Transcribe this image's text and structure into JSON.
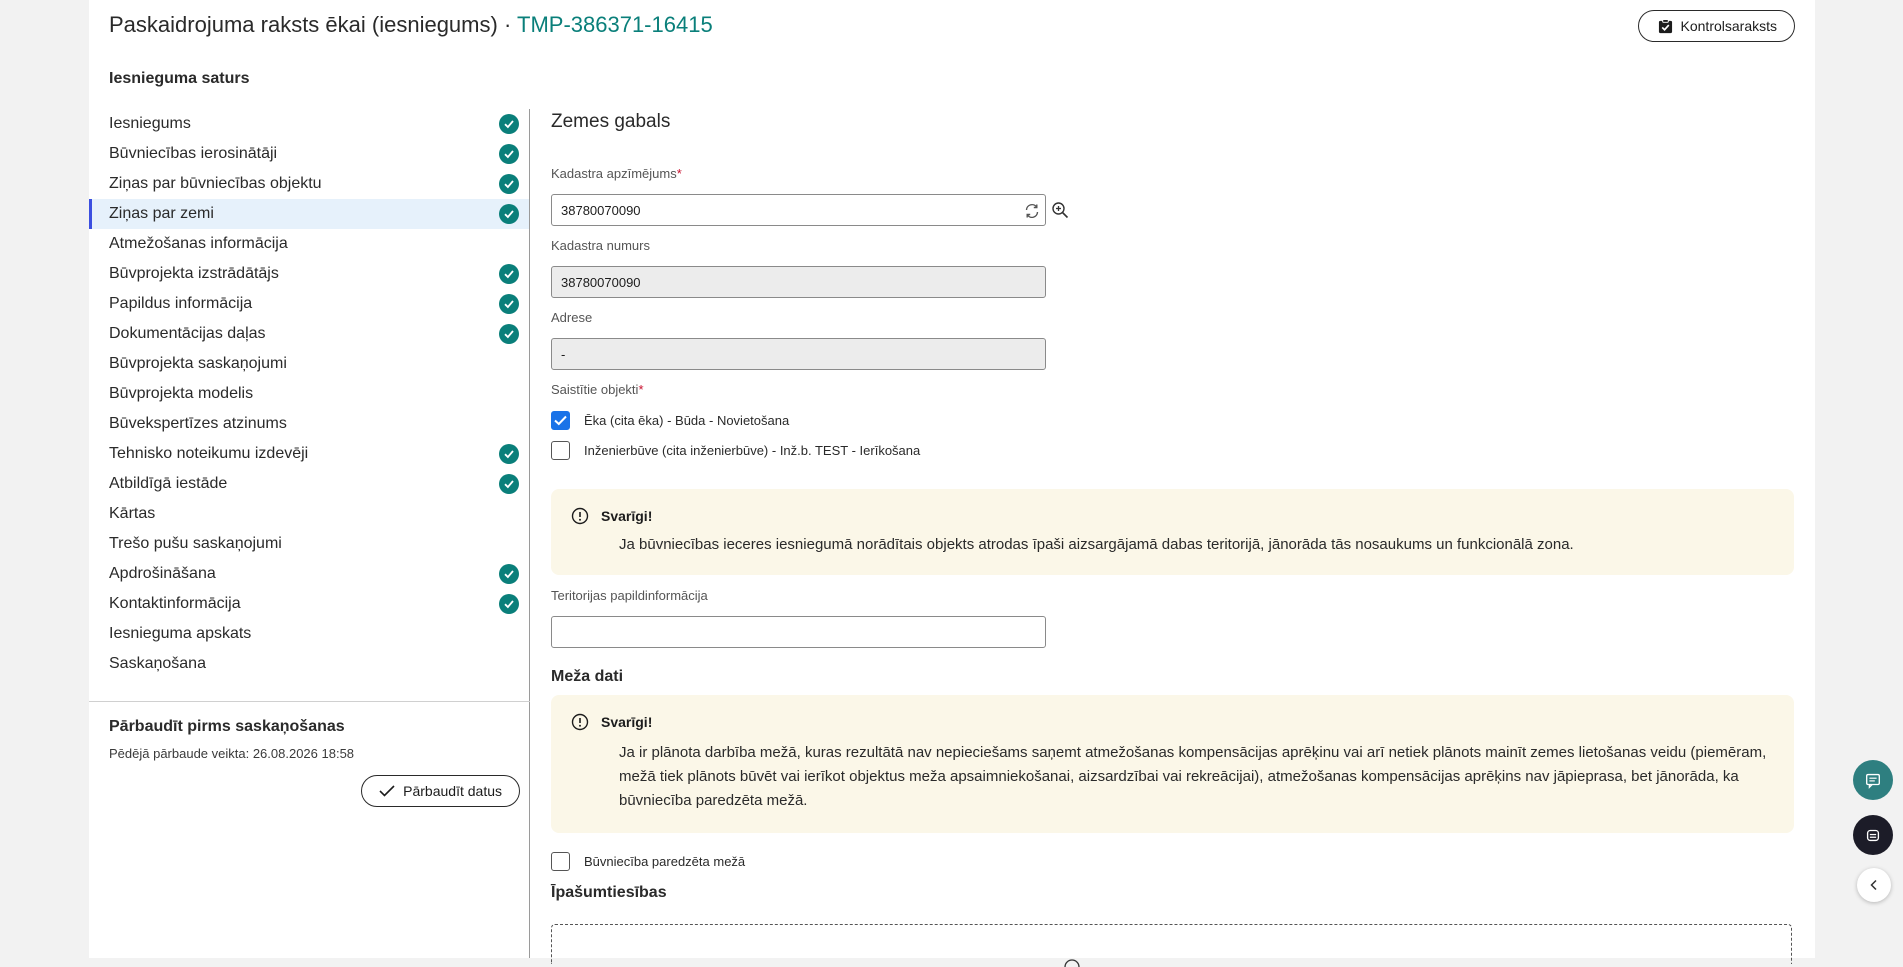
{
  "header": {
    "title": "Paskaidrojuma raksts ēkai (iesniegums)",
    "separator": "·",
    "code": "TMP-386371-16415",
    "checklist_label": "Kontrolsaraksts"
  },
  "sidebar": {
    "title": "Iesnieguma saturs",
    "items": [
      {
        "label": "Iesniegums",
        "done": true
      },
      {
        "label": "Būvniecības ierosinātāji",
        "done": true
      },
      {
        "label": "Ziņas par būvniecības objektu",
        "done": true
      },
      {
        "label": "Ziņas par zemi",
        "done": true,
        "active": true
      },
      {
        "label": "Atmežošanas informācija",
        "done": false
      },
      {
        "label": "Būvprojekta izstrādātājs",
        "done": true
      },
      {
        "label": "Papildus informācija",
        "done": true
      },
      {
        "label": "Dokumentācijas daļas",
        "done": true
      },
      {
        "label": "Būvprojekta saskaņojumi",
        "done": false
      },
      {
        "label": "Būvprojekta modelis",
        "done": false
      },
      {
        "label": "Būvekspertīzes atzinums",
        "done": false
      },
      {
        "label": "Tehnisko noteikumu izdevēji",
        "done": true
      },
      {
        "label": "Atbildīgā iestāde",
        "done": true
      },
      {
        "label": "Kārtas",
        "done": false
      },
      {
        "label": "Trešo pušu saskaņojumi",
        "done": false
      },
      {
        "label": "Apdrošināšana",
        "done": true
      },
      {
        "label": "Kontaktinformācija",
        "done": true
      },
      {
        "label": "Iesnieguma apskats",
        "done": false
      },
      {
        "label": "Saskaņošana",
        "done": false
      }
    ],
    "verify": {
      "title": "Pārbaudīt pirms saskaņošanas",
      "last_check": "Pēdējā pārbaude veikta: 26.08.2026 18:58",
      "button_label": "Pārbaudīt datus"
    }
  },
  "main": {
    "section_title": "Zemes gabals",
    "cadastre_designation": {
      "label": "Kadastra apzīmējums",
      "required": "*",
      "value": "38780070090"
    },
    "cadastre_number": {
      "label": "Kadastra numurs",
      "value": "38780070090"
    },
    "address": {
      "label": "Adrese",
      "value": "-"
    },
    "linked_objects": {
      "label": "Saistītie objekti",
      "required": "*",
      "items": [
        {
          "label": "Ēka (cita ēka) - Būda - Novietošana",
          "checked": true
        },
        {
          "label": "Inženierbūve (cita inženierbūve) - Inž.b. TEST - Ierīkošana",
          "checked": false
        }
      ]
    },
    "notice1": {
      "title": "Svarīgi!",
      "text": "Ja būvniecības ieceres iesniegumā norādītais objekts atrodas īpaši aizsargājamā dabas teritorijā, jānorāda tās nosaukums un funkcionālā zona."
    },
    "territory_info": {
      "label": "Teritorijas papildinformācija",
      "value": ""
    },
    "forest": {
      "title": "Meža dati",
      "notice": {
        "title": "Svarīgi!",
        "text": "Ja ir plānota darbība mežā, kuras rezultātā nav nepieciešams saņemt atmežošanas kompensācijas aprēķinu vai arī netiek plānots mainīt zemes lietošanas veidu (piemēram, mežā tiek plānots būvēt vai ierīkot objektus meža apsaimniekošanai, aizsardzībai vai rekreācijai), atmežošanas kompensācijas aprēķins nav jāpieprasa, bet jānorāda, ka būvniecība paredzēta mežā."
      },
      "checkbox": {
        "label": "Būvniecība paredzēta mežā",
        "checked": false
      }
    },
    "ownership_title": "Īpašumtiesības"
  },
  "colors": {
    "accent": "#0a7f7a",
    "active_bar": "#3b4fe0",
    "notice_bg": "#fbf7e8",
    "checkbox": "#1a73e8"
  }
}
